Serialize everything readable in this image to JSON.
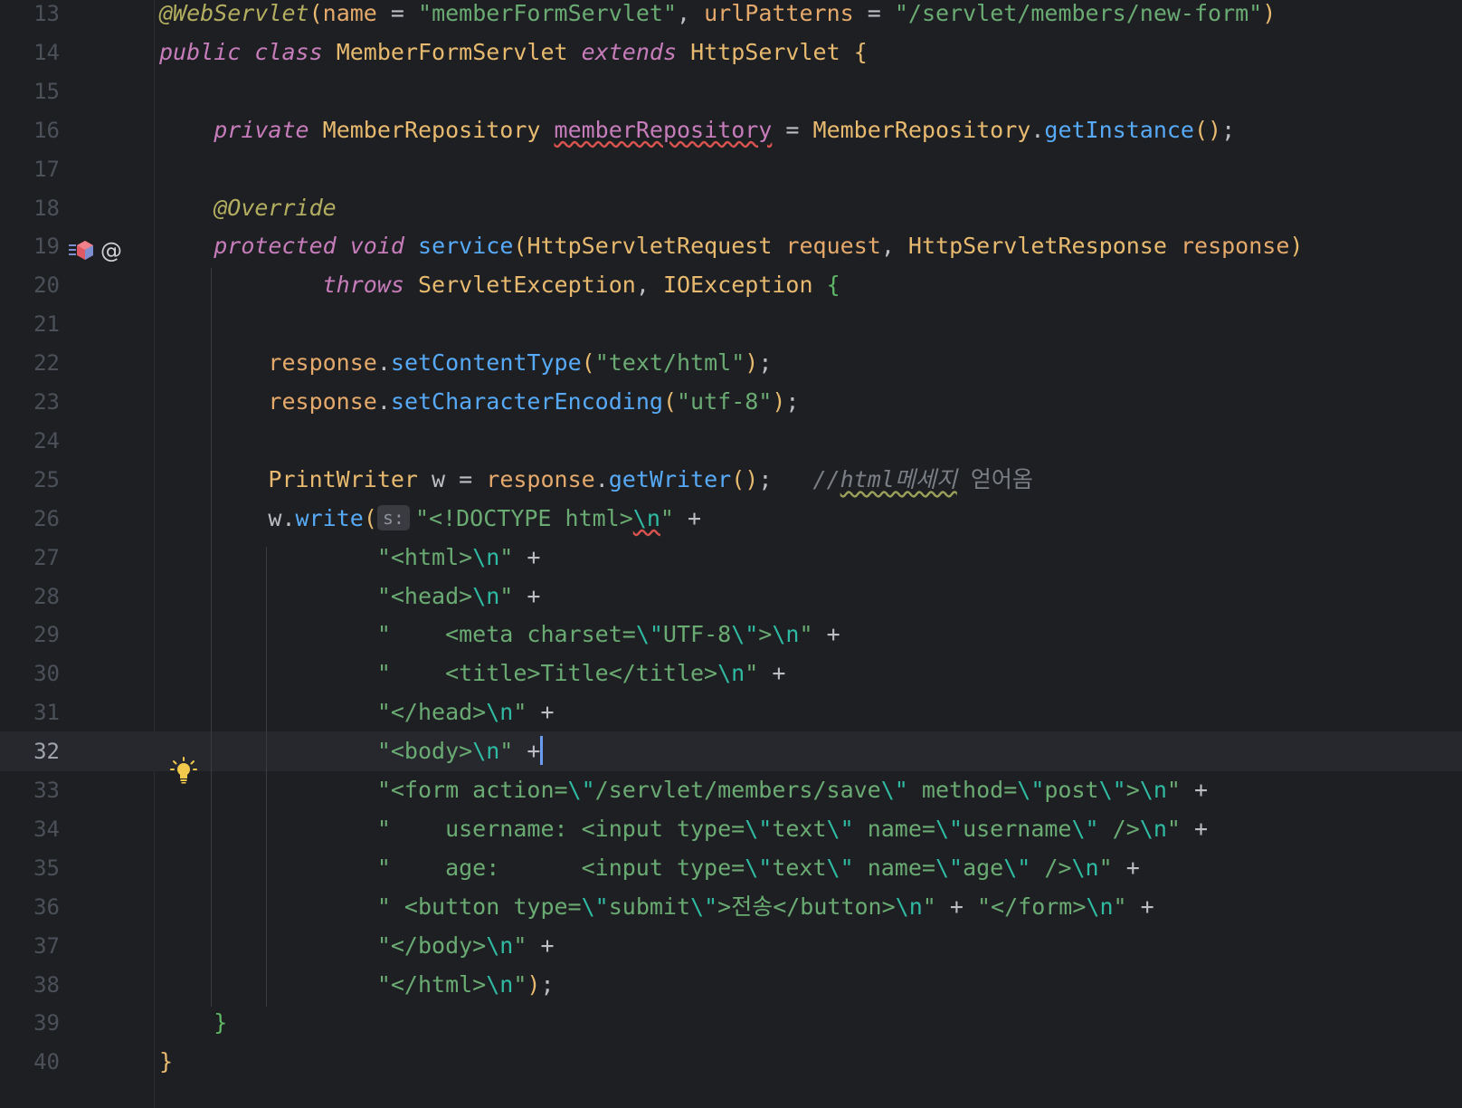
{
  "editor": {
    "current_line": "32",
    "lines": [
      {
        "n": "13",
        "tokens": [
          [
            "@WebServlet",
            "ann"
          ],
          [
            "(",
            "p1"
          ],
          [
            "name",
            "param"
          ],
          [
            " = ",
            "br"
          ],
          [
            "\"memberFormServlet\"",
            "str"
          ],
          [
            ", ",
            "br"
          ],
          [
            "urlPatterns",
            "param"
          ],
          [
            " = ",
            "br"
          ],
          [
            "\"/servlet/members/new-form\"",
            "str"
          ],
          [
            ")",
            "p1"
          ]
        ]
      },
      {
        "n": "14",
        "tokens": [
          [
            "public",
            "kw"
          ],
          [
            " ",
            "br"
          ],
          [
            "class",
            "kw"
          ],
          [
            " ",
            "br"
          ],
          [
            "MemberFormServlet",
            "cls"
          ],
          [
            " ",
            "br"
          ],
          [
            "extends",
            "kw"
          ],
          [
            " ",
            "br"
          ],
          [
            "HttpServlet",
            "cls"
          ],
          [
            " ",
            "br"
          ],
          [
            "{",
            "p1"
          ]
        ]
      },
      {
        "n": "15",
        "tokens": []
      },
      {
        "n": "16",
        "tokens": [
          [
            "    ",
            "br"
          ],
          [
            "private",
            "kw"
          ],
          [
            " ",
            "br"
          ],
          [
            "MemberRepository",
            "cls"
          ],
          [
            " ",
            "br"
          ],
          [
            "memberRepository",
            "field squig"
          ],
          [
            " = ",
            "br"
          ],
          [
            "MemberRepository",
            "cls"
          ],
          [
            ".",
            "br"
          ],
          [
            "getInstance",
            "fn"
          ],
          [
            "()",
            "p1"
          ],
          [
            ";",
            "br"
          ]
        ]
      },
      {
        "n": "17",
        "tokens": []
      },
      {
        "n": "18",
        "tokens": [
          [
            "    ",
            "br"
          ],
          [
            "@Override",
            "ann"
          ]
        ]
      },
      {
        "n": "19",
        "tokens": [
          [
            "    ",
            "br"
          ],
          [
            "protected",
            "kw"
          ],
          [
            " ",
            "br"
          ],
          [
            "void",
            "kw"
          ],
          [
            " ",
            "br"
          ],
          [
            "service",
            "fn"
          ],
          [
            "(",
            "p1"
          ],
          [
            "HttpServletRequest",
            "cls"
          ],
          [
            " ",
            "br"
          ],
          [
            "request",
            "param"
          ],
          [
            ", ",
            "br"
          ],
          [
            "HttpServletResponse",
            "cls"
          ],
          [
            " ",
            "br"
          ],
          [
            "response",
            "param"
          ],
          [
            ")",
            "p1"
          ]
        ]
      },
      {
        "n": "20",
        "tokens": [
          [
            "            ",
            "br"
          ],
          [
            "throws",
            "kw"
          ],
          [
            " ",
            "br"
          ],
          [
            "ServletException",
            "cls"
          ],
          [
            ", ",
            "br"
          ],
          [
            "IOException",
            "cls"
          ],
          [
            " ",
            "br"
          ],
          [
            "{",
            "p2"
          ]
        ]
      },
      {
        "n": "21",
        "tokens": []
      },
      {
        "n": "22",
        "tokens": [
          [
            "        ",
            "br"
          ],
          [
            "response",
            "param"
          ],
          [
            ".",
            "br"
          ],
          [
            "setContentType",
            "fn"
          ],
          [
            "(",
            "p1"
          ],
          [
            "\"text/html\"",
            "str"
          ],
          [
            ")",
            "p1"
          ],
          [
            ";",
            "br"
          ]
        ]
      },
      {
        "n": "23",
        "tokens": [
          [
            "        ",
            "br"
          ],
          [
            "response",
            "param"
          ],
          [
            ".",
            "br"
          ],
          [
            "setCharacterEncoding",
            "fn"
          ],
          [
            "(",
            "p1"
          ],
          [
            "\"utf-8\"",
            "str"
          ],
          [
            ")",
            "p1"
          ],
          [
            ";",
            "br"
          ]
        ]
      },
      {
        "n": "24",
        "tokens": []
      },
      {
        "n": "25",
        "tokens": [
          [
            "        ",
            "br"
          ],
          [
            "PrintWriter",
            "cls"
          ],
          [
            " w = ",
            "br"
          ],
          [
            "response",
            "param"
          ],
          [
            ".",
            "br"
          ],
          [
            "getWriter",
            "fn"
          ],
          [
            "()",
            "p1"
          ],
          [
            ";",
            "br"
          ],
          [
            "   ",
            "br"
          ],
          [
            "//",
            "cmt"
          ],
          [
            "html메세지",
            "cmt squig-g"
          ],
          [
            " 얻어옴",
            "cmtk"
          ]
        ]
      },
      {
        "n": "26",
        "tokens": [
          [
            "        ",
            "br"
          ],
          [
            "w",
            "br"
          ],
          [
            ".",
            "br"
          ],
          [
            "write",
            "fn"
          ],
          [
            "(",
            "p1"
          ],
          [
            "s:",
            "hint"
          ],
          [
            "\"<!DOCTYPE html>",
            "str"
          ],
          [
            "\\n",
            "esc squig"
          ],
          [
            "\"",
            "str"
          ],
          [
            " +",
            "br"
          ]
        ]
      },
      {
        "n": "27",
        "tokens": [
          [
            "                ",
            "br"
          ],
          [
            "\"<html>",
            "str"
          ],
          [
            "\\n",
            "esc"
          ],
          [
            "\"",
            "str"
          ],
          [
            " +",
            "br"
          ]
        ]
      },
      {
        "n": "28",
        "tokens": [
          [
            "                ",
            "br"
          ],
          [
            "\"<head>",
            "str"
          ],
          [
            "\\n",
            "esc"
          ],
          [
            "\"",
            "str"
          ],
          [
            " +",
            "br"
          ]
        ]
      },
      {
        "n": "29",
        "tokens": [
          [
            "                ",
            "br"
          ],
          [
            "\"    <meta charset=",
            "str"
          ],
          [
            "\\\"",
            "esc"
          ],
          [
            "UTF-8",
            "str"
          ],
          [
            "\\\"",
            "esc"
          ],
          [
            ">",
            "str"
          ],
          [
            "\\n",
            "esc"
          ],
          [
            "\"",
            "str"
          ],
          [
            " +",
            "br"
          ]
        ]
      },
      {
        "n": "30",
        "tokens": [
          [
            "                ",
            "br"
          ],
          [
            "\"    <title>Title</title>",
            "str"
          ],
          [
            "\\n",
            "esc"
          ],
          [
            "\"",
            "str"
          ],
          [
            " +",
            "br"
          ]
        ]
      },
      {
        "n": "31",
        "tokens": [
          [
            "                ",
            "br"
          ],
          [
            "\"</head>",
            "str"
          ],
          [
            "\\n",
            "esc"
          ],
          [
            "\"",
            "str"
          ],
          [
            " +",
            "br"
          ]
        ]
      },
      {
        "n": "32",
        "tokens": [
          [
            "                ",
            "br"
          ],
          [
            "\"<body>",
            "str"
          ],
          [
            "\\n",
            "esc"
          ],
          [
            "\"",
            "str"
          ],
          [
            " +",
            "br"
          ],
          [
            "",
            "caret"
          ]
        ]
      },
      {
        "n": "33",
        "tokens": [
          [
            "                ",
            "br"
          ],
          [
            "\"<form action=",
            "str"
          ],
          [
            "\\\"",
            "esc"
          ],
          [
            "/servlet/members/save",
            "str"
          ],
          [
            "\\\"",
            "esc"
          ],
          [
            " method=",
            "str"
          ],
          [
            "\\\"",
            "esc"
          ],
          [
            "post",
            "str"
          ],
          [
            "\\\"",
            "esc"
          ],
          [
            ">",
            "str"
          ],
          [
            "\\n",
            "esc"
          ],
          [
            "\"",
            "str"
          ],
          [
            " +",
            "br"
          ]
        ]
      },
      {
        "n": "34",
        "tokens": [
          [
            "                ",
            "br"
          ],
          [
            "\"    username: <input type=",
            "str"
          ],
          [
            "\\\"",
            "esc"
          ],
          [
            "text",
            "str"
          ],
          [
            "\\\"",
            "esc"
          ],
          [
            " name=",
            "str"
          ],
          [
            "\\\"",
            "esc"
          ],
          [
            "username",
            "str"
          ],
          [
            "\\\"",
            "esc"
          ],
          [
            " />",
            "str"
          ],
          [
            "\\n",
            "esc"
          ],
          [
            "\"",
            "str"
          ],
          [
            " +",
            "br"
          ]
        ]
      },
      {
        "n": "35",
        "tokens": [
          [
            "                ",
            "br"
          ],
          [
            "\"    age:      <input type=",
            "str"
          ],
          [
            "\\\"",
            "esc"
          ],
          [
            "text",
            "str"
          ],
          [
            "\\\"",
            "esc"
          ],
          [
            " name=",
            "str"
          ],
          [
            "\\\"",
            "esc"
          ],
          [
            "age",
            "str"
          ],
          [
            "\\\"",
            "esc"
          ],
          [
            " />",
            "str"
          ],
          [
            "\\n",
            "esc"
          ],
          [
            "\"",
            "str"
          ],
          [
            " +",
            "br"
          ]
        ]
      },
      {
        "n": "36",
        "tokens": [
          [
            "                ",
            "br"
          ],
          [
            "\" <button type=",
            "str"
          ],
          [
            "\\\"",
            "esc"
          ],
          [
            "submit",
            "str"
          ],
          [
            "\\\"",
            "esc"
          ],
          [
            ">전송</button>",
            "str"
          ],
          [
            "\\n",
            "esc"
          ],
          [
            "\"",
            "str"
          ],
          [
            " + ",
            "br"
          ],
          [
            "\"</form>",
            "str"
          ],
          [
            "\\n",
            "esc"
          ],
          [
            "\"",
            "str"
          ],
          [
            " +",
            "br"
          ]
        ]
      },
      {
        "n": "37",
        "tokens": [
          [
            "                ",
            "br"
          ],
          [
            "\"</body>",
            "str"
          ],
          [
            "\\n",
            "esc"
          ],
          [
            "\"",
            "str"
          ],
          [
            " +",
            "br"
          ]
        ]
      },
      {
        "n": "38",
        "tokens": [
          [
            "                ",
            "br"
          ],
          [
            "\"</html>",
            "str"
          ],
          [
            "\\n",
            "esc"
          ],
          [
            "\"",
            "str"
          ],
          [
            ")",
            "p1"
          ],
          [
            ";",
            "br"
          ]
        ]
      },
      {
        "n": "39",
        "tokens": [
          [
            "    ",
            "br"
          ],
          [
            "}",
            "p2"
          ]
        ]
      },
      {
        "n": "40",
        "tokens": [
          [
            "}",
            "p1"
          ]
        ]
      }
    ]
  },
  "gutter": {
    "icons": [
      "implements-method-icon",
      "annotation-at-icon",
      "lightbulb-icon"
    ],
    "at_symbol": "@"
  },
  "colors": {
    "background": "#1e1f22",
    "keyword": "#c77dbb",
    "annotation": "#b3ae60",
    "class": "#e8ba6f",
    "string": "#6aab73",
    "escape": "#2fbaa3",
    "method": "#57aaf7",
    "parameter": "#e5a96c",
    "comment": "#7a7e85",
    "caret": "#6b9bf0"
  }
}
